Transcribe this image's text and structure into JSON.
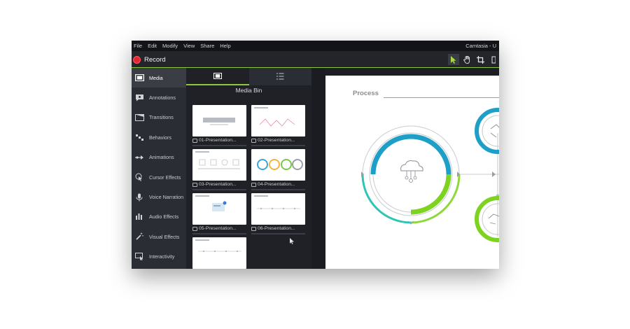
{
  "menu": {
    "items": [
      "File",
      "Edit",
      "Modify",
      "View",
      "Share",
      "Help"
    ],
    "app_title": "Camtasia - U"
  },
  "toolbar": {
    "record_label": "Record",
    "tools": [
      "select-arrow-icon",
      "hand-pan-icon",
      "crop-icon"
    ]
  },
  "sidebar": {
    "items": [
      {
        "label": "Media",
        "icon": "film-strip-icon",
        "active": true
      },
      {
        "label": "Annotations",
        "icon": "speech-bubble-icon",
        "active": false
      },
      {
        "label": "Transitions",
        "icon": "transition-icon",
        "active": false
      },
      {
        "label": "Behaviors",
        "icon": "behaviors-icon",
        "active": false
      },
      {
        "label": "Animations",
        "icon": "animation-arrow-icon",
        "active": false
      },
      {
        "label": "Cursor Effects",
        "icon": "cursor-effect-icon",
        "active": false
      },
      {
        "label": "Voice Narration",
        "icon": "microphone-icon",
        "active": false
      },
      {
        "label": "Audio Effects",
        "icon": "audio-bars-icon",
        "active": false
      },
      {
        "label": "Visual Effects",
        "icon": "magic-wand-icon",
        "active": false
      },
      {
        "label": "Interactivity",
        "icon": "interactive-screen-icon",
        "active": false
      }
    ]
  },
  "media_panel": {
    "tabs": [
      "film-strip-icon",
      "list-icon"
    ],
    "title": "Media Bin",
    "items": [
      {
        "label": "01-Presentation..."
      },
      {
        "label": "02-Presentation..."
      },
      {
        "label": "03-Presentation..."
      },
      {
        "label": "04-Presentation..."
      },
      {
        "label": "05-Presentation..."
      },
      {
        "label": "06-Presentation..."
      },
      {
        "label": ""
      }
    ]
  },
  "canvas": {
    "heading": "Process"
  },
  "colors": {
    "accent_green": "#8dc63f",
    "record_red": "#e8262f",
    "ring_blue": "#1e9fc8",
    "ring_green": "#7ed321"
  }
}
